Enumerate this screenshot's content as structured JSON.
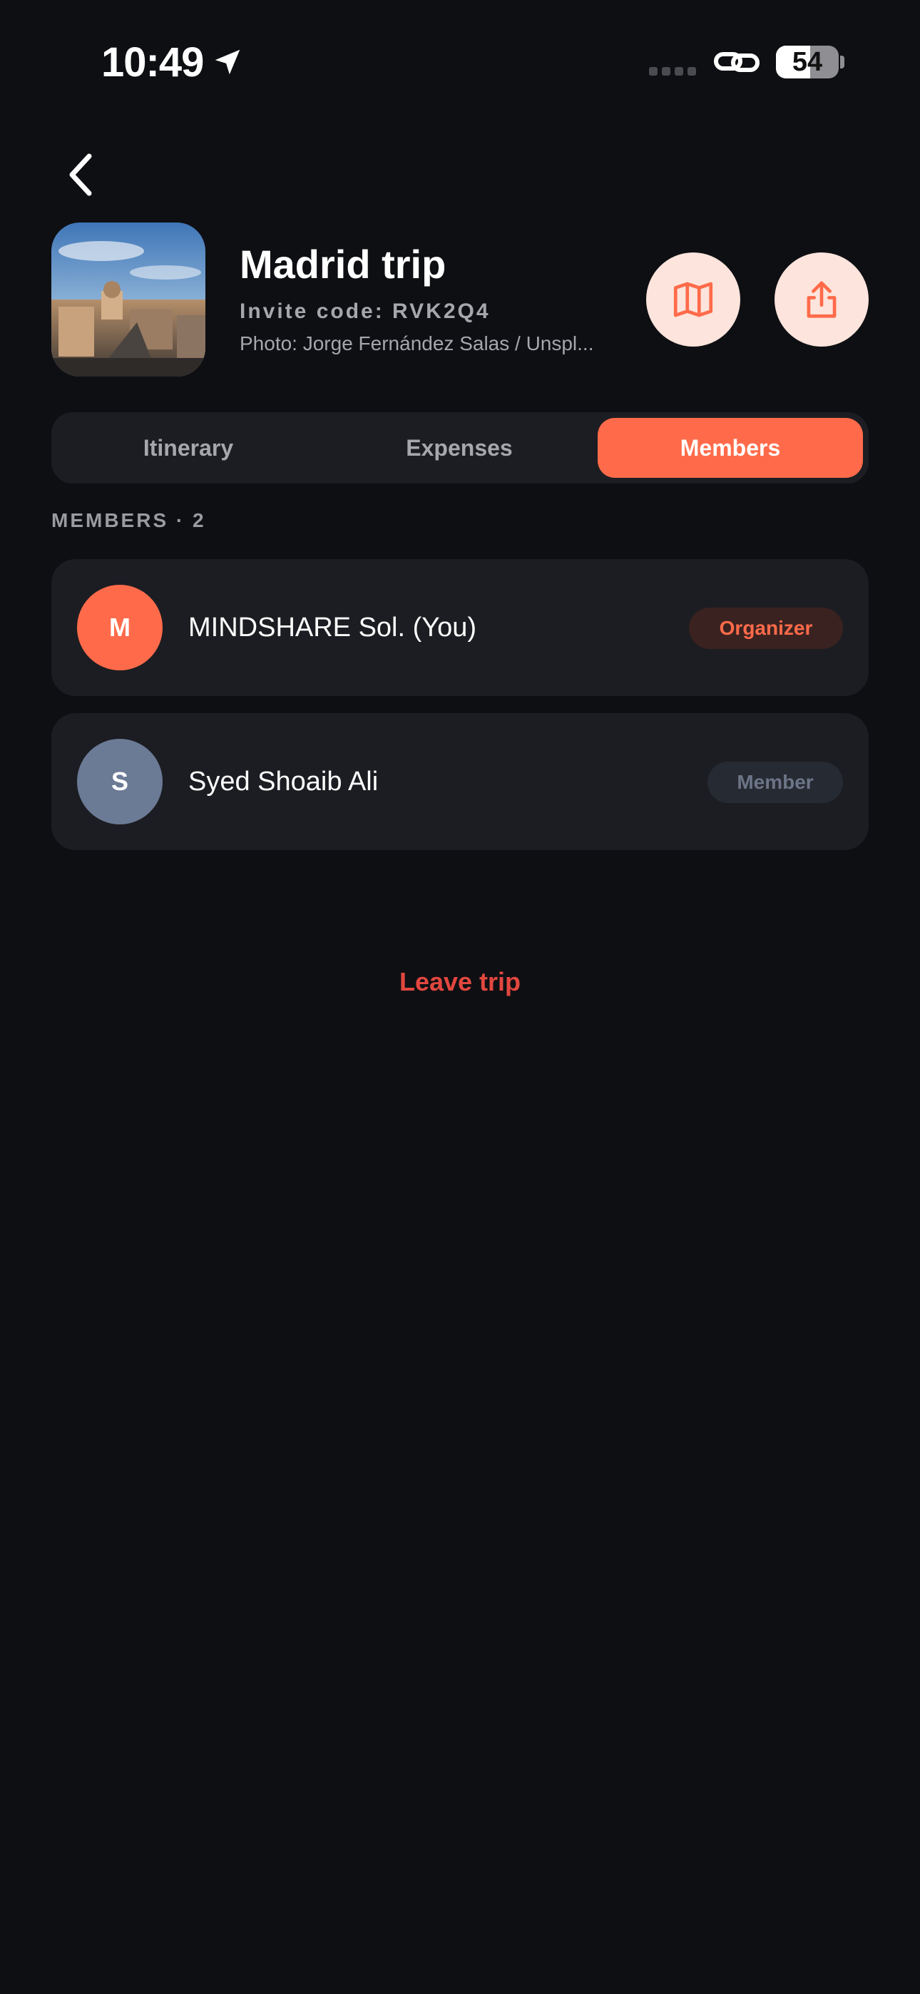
{
  "status_bar": {
    "time": "10:49",
    "battery_percent": "54",
    "icons": [
      "location-arrow-icon",
      "signal-dots-icon",
      "link-icon",
      "battery-icon"
    ]
  },
  "header": {
    "back_icon": "chevron-left-icon",
    "title": "Madrid trip",
    "invite_code": "Invite code: RVK2Q4",
    "photo_credit": "Photo: Jorge Fernández Salas / Unspl...",
    "map_icon": "map-icon",
    "share_icon": "share-icon"
  },
  "tabs": [
    {
      "label": "Itinerary",
      "active": false
    },
    {
      "label": "Expenses",
      "active": false
    },
    {
      "label": "Members",
      "active": true
    }
  ],
  "members_section": {
    "label": "MEMBERS · 2",
    "members": [
      {
        "initial": "M",
        "name": "MINDSHARE Sol. (You)",
        "role": "Organizer",
        "avatar_color": "#ff6b4a"
      },
      {
        "initial": "S",
        "name": "Syed Shoaib Ali",
        "role": "Member",
        "avatar_color": "#6b7a95"
      }
    ]
  },
  "actions": {
    "leave_trip": "Leave trip"
  },
  "colors": {
    "background": "#0e0f13",
    "card": "#1c1d22",
    "accent": "#ff6b4a",
    "danger": "#e2473f",
    "circle_button_bg": "#fde4dc"
  }
}
